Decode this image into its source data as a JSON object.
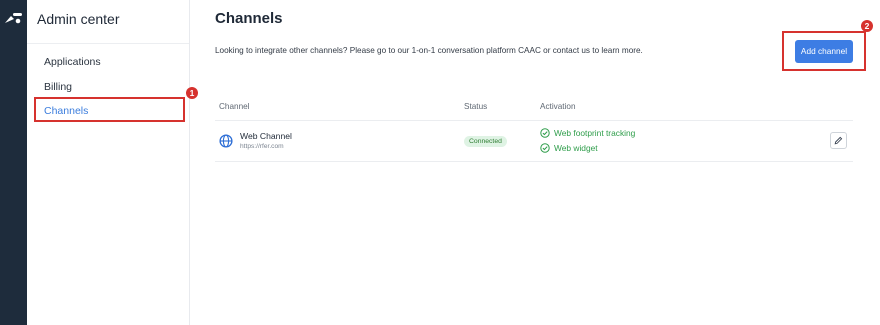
{
  "sidebar": {
    "title": "Admin center",
    "items": [
      {
        "label": "Applications",
        "active": false
      },
      {
        "label": "Billing",
        "active": false
      },
      {
        "label": "Channels",
        "active": true
      }
    ]
  },
  "annotations": {
    "badge_1": "1",
    "badge_2": "2"
  },
  "main": {
    "title": "Channels",
    "info_text": "Looking to integrate other channels? Please go to our 1-on-1 conversation platform CAAC or contact us to learn more.",
    "add_button_label": "Add channel",
    "table": {
      "columns": [
        "Channel",
        "Status",
        "Activation"
      ],
      "rows": [
        {
          "icon": "globe-icon",
          "name": "Web Channel",
          "url": "https://rfer.com",
          "status": "Connected",
          "activations": [
            "Web footprint tracking",
            "Web widget"
          ]
        }
      ]
    }
  },
  "colors": {
    "rail": "#1e2c3c",
    "accent": "#3d7de4",
    "highlight": "#d6322e",
    "success": "#2e9d4a",
    "status_bg": "#dff3e4"
  }
}
